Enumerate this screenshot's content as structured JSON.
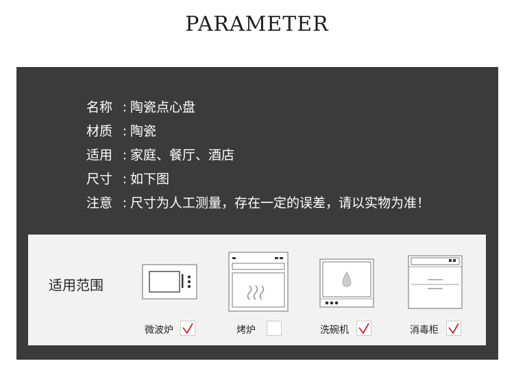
{
  "header": {
    "title": "PARAMETER"
  },
  "params": [
    {
      "key": "名称",
      "sep": ":",
      "value": "陶瓷点心盘"
    },
    {
      "key": "材质",
      "sep": ":",
      "value": "陶瓷"
    },
    {
      "key": "适用",
      "sep": ":",
      "value": "家庭、餐厅、酒店"
    },
    {
      "key": "尺寸",
      "sep": ":",
      "value": "如下图"
    },
    {
      "key": "注意",
      "sep": ":",
      "value": "尺寸为人工测量，存在一定的误差，请以实物为准！"
    }
  ],
  "scope": {
    "label": "适用范围",
    "appliances": [
      {
        "name": "微波炉",
        "icon": "microwave-icon",
        "checked": true
      },
      {
        "name": "烤炉",
        "icon": "oven-icon",
        "checked": false
      },
      {
        "name": "洗碗机",
        "icon": "dishwasher-icon",
        "checked": true
      },
      {
        "name": "消毒柜",
        "icon": "sterilizer-icon",
        "checked": true
      }
    ]
  },
  "colors": {
    "panel": "#3b3b3b",
    "check_mark": "#cc2222",
    "scope_bg": "#f2f2f2"
  }
}
